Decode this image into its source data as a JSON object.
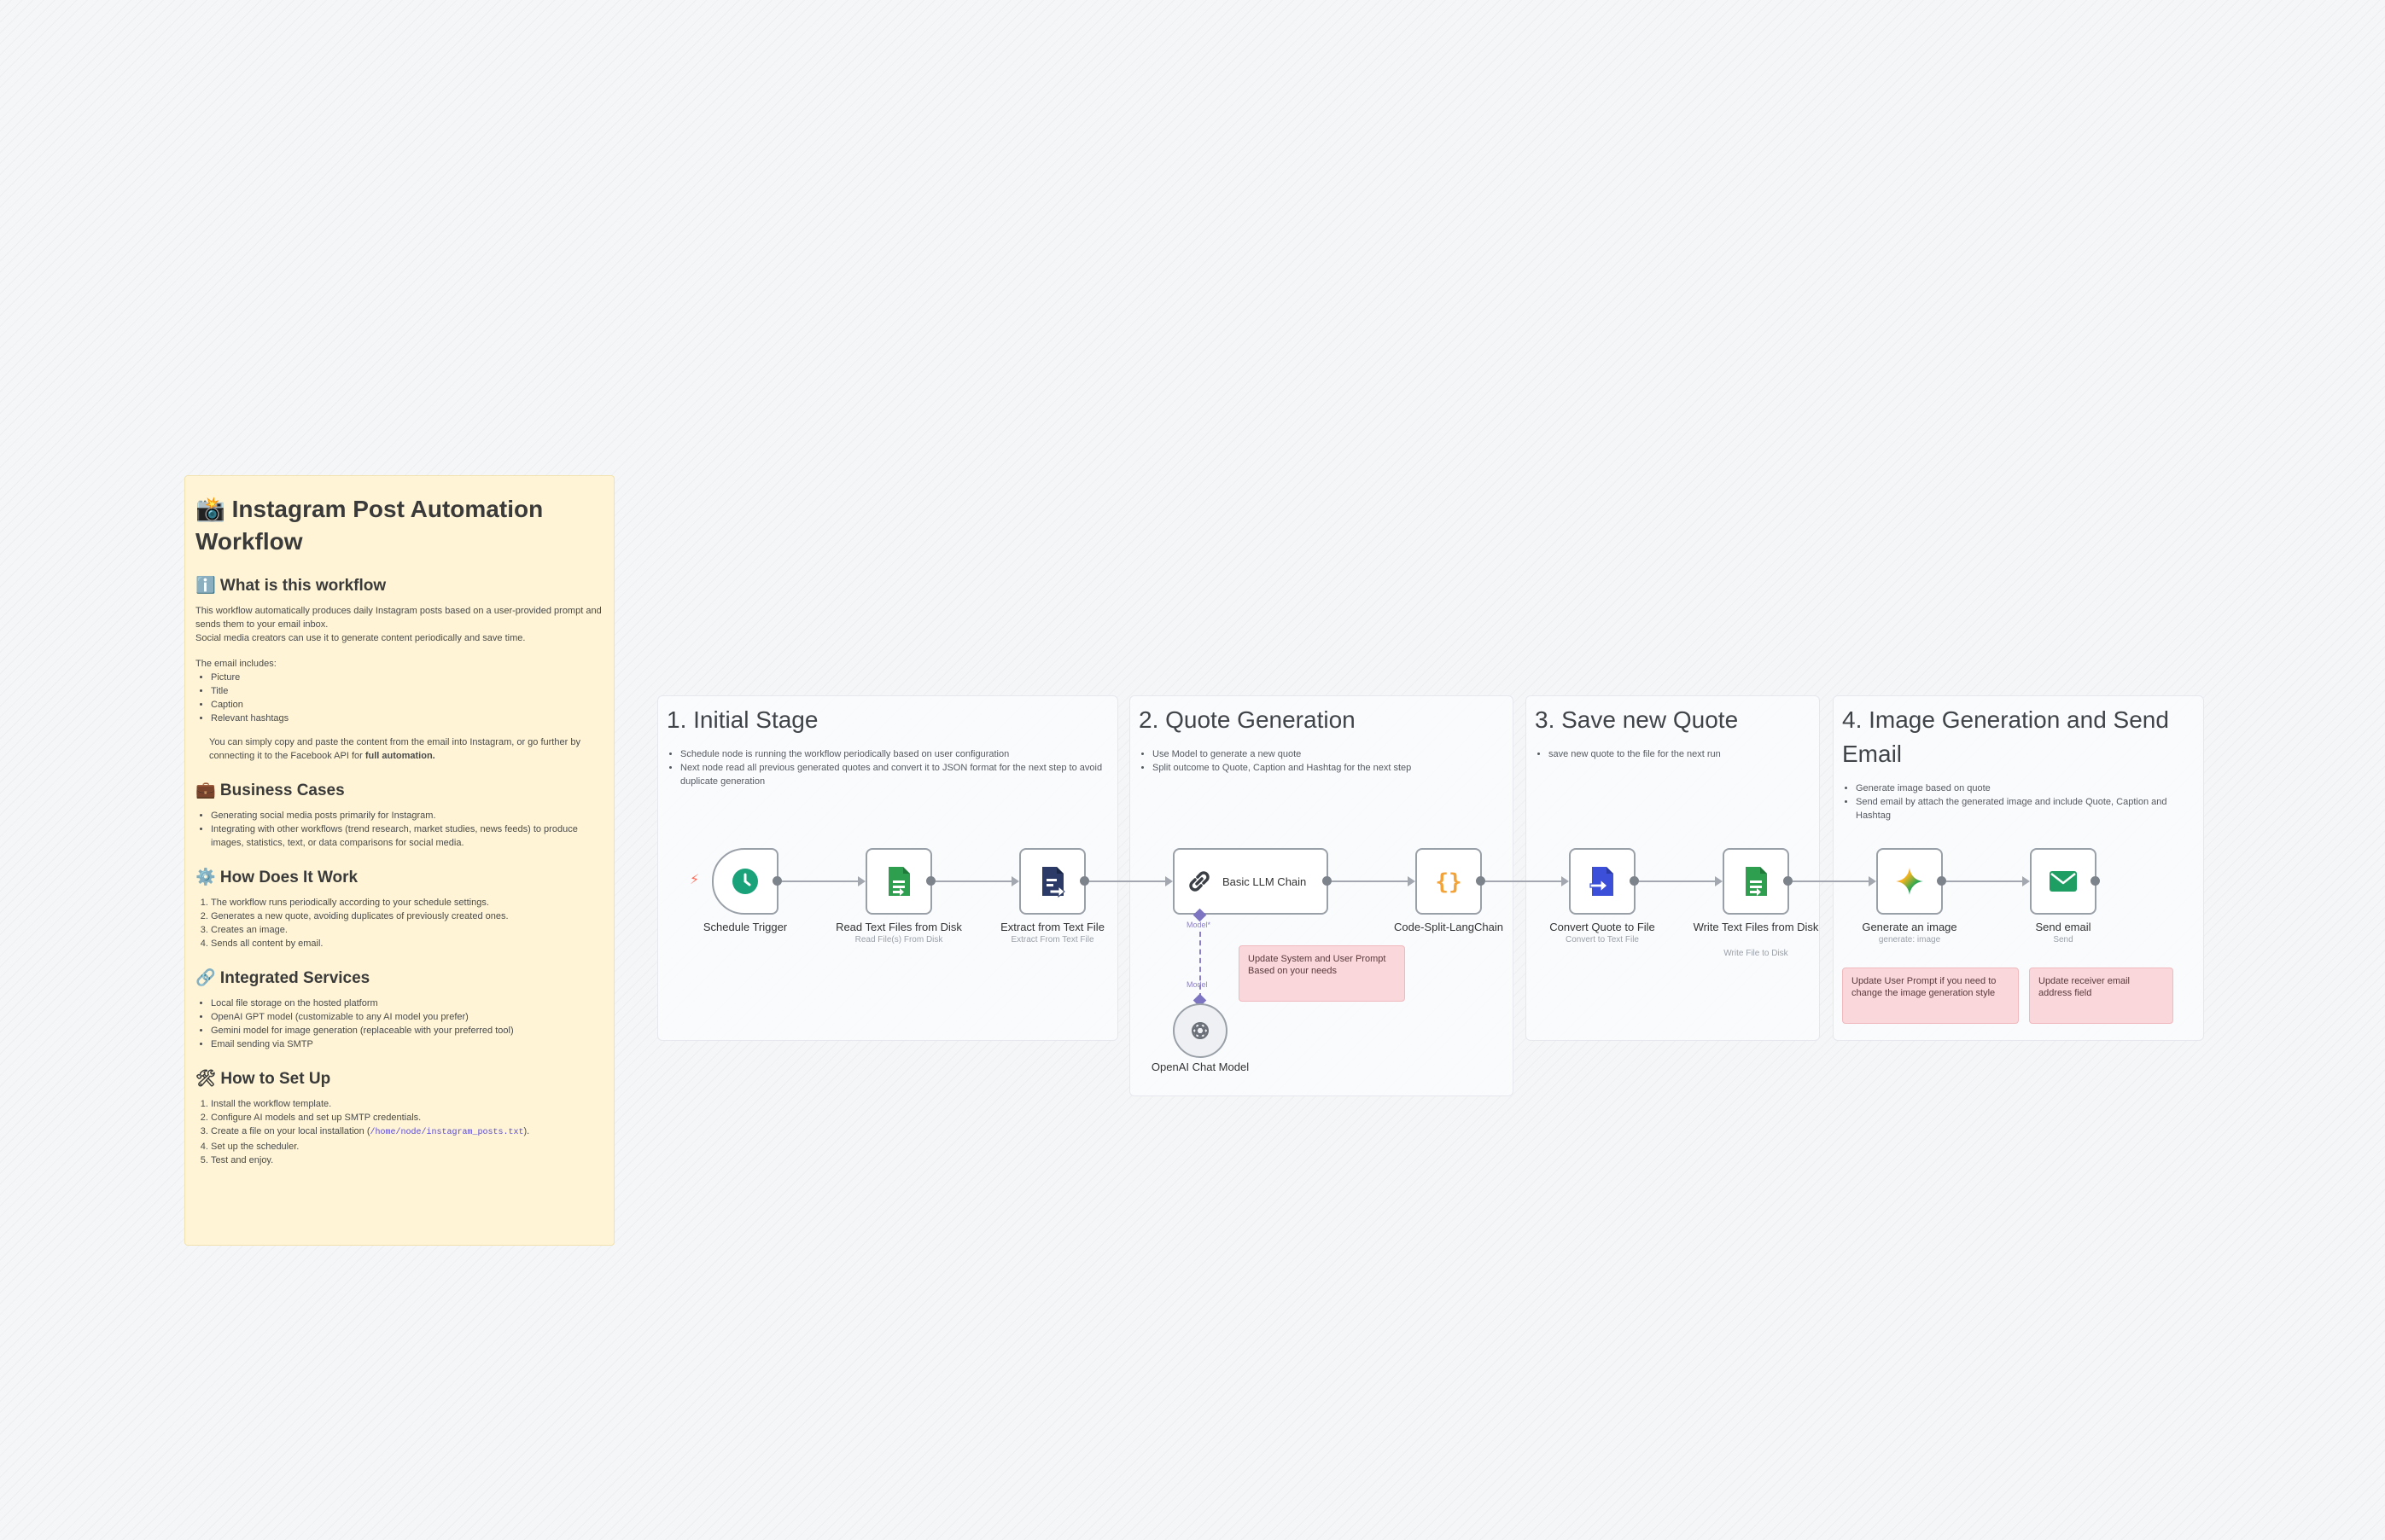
{
  "main_note": {
    "title": "📸 Instagram Post Automation Workflow",
    "what_heading": "ℹ️ What is this workflow",
    "what_p1": "This workflow automatically produces daily Instagram posts based on a user-provided prompt and sends them to your email inbox.",
    "what_p2": "Social media creators can use it to generate content periodically and save time.",
    "email_includes": "The email includes:",
    "email_items": [
      "Picture",
      "Title",
      "Caption",
      "Relevant hashtags"
    ],
    "tip_text": "You can simply copy and paste the content from the email into Instagram, or go further by connecting it to the Facebook API for",
    "tip_bold": "full automation.",
    "business_heading": "💼 Business Cases",
    "business_items": [
      "Generating social media posts primarily for Instagram.",
      "Integrating with other workflows (trend research, market studies, news feeds) to produce images, statistics, text, or data comparisons for social media."
    ],
    "how_heading": "⚙️ How Does It Work",
    "how_items": [
      "The workflow runs periodically according to your schedule settings.",
      "Generates a new quote, avoiding duplicates of previously created ones.",
      "Creates an image.",
      "Sends all content by email."
    ],
    "services_heading": "🔗 Integrated Services",
    "services_items": [
      "Local file storage on the hosted platform",
      "OpenAI GPT model (customizable to any AI model you prefer)",
      "Gemini model for image generation (replaceable with your preferred tool)",
      "Email sending via SMTP"
    ],
    "setup_heading": "🛠 How to Set Up",
    "setup_1": "Install the workflow template.",
    "setup_2": "Configure AI models and set up SMTP credentials.",
    "setup_3_pre": "Create a file on your local installation (",
    "setup_3_code": "/home/node/instagram_posts.txt",
    "setup_3_post": ").",
    "setup_4": "Set up the scheduler.",
    "setup_5": "Test and enjoy."
  },
  "sections": {
    "s1": {
      "title": "1. Initial Stage",
      "items": [
        "Schedule node is running the workflow periodically based on user configuration",
        "Next node read all previous generated quotes and convert it to JSON format for the next step to avoid duplicate generation"
      ]
    },
    "s2": {
      "title": "2. Quote Generation",
      "items": [
        "Use Model to generate a new quote",
        "Split outcome to Quote, Caption and Hashtag for the next step"
      ]
    },
    "s3": {
      "title": "3. Save new Quote",
      "items": [
        "save new quote to the file for the next run"
      ]
    },
    "s4": {
      "title": "4. Image Generation and Send Email",
      "items": [
        "Generate image based on quote",
        "Send email by attach the generated image and include Quote, Caption and Hashtag"
      ]
    }
  },
  "nodes": {
    "schedule": {
      "label": "Schedule Trigger",
      "icon": "clock-icon"
    },
    "read": {
      "label": "Read Text Files from Disk",
      "sub": "Read File(s) From Disk",
      "icon": "file-read-icon"
    },
    "extract": {
      "label": "Extract from Text File",
      "sub": "Extract From Text File",
      "icon": "file-extract-icon"
    },
    "llm": {
      "label": "Basic LLM Chain",
      "icon": "link-chain-icon",
      "model_label": "Model*"
    },
    "code": {
      "label": "Code-Split-LangChain",
      "icon": "braces-icon"
    },
    "convert": {
      "label": "Convert Quote to File",
      "sub": "Convert to Text File",
      "icon": "file-convert-icon"
    },
    "write": {
      "label": "Write Text Files from Disk",
      "sub": "Write File to Disk",
      "icon": "file-write-icon"
    },
    "image": {
      "label": "Generate an image",
      "sub": "generate: image",
      "icon": "gemini-sparkle-icon"
    },
    "email": {
      "label": "Send email",
      "sub": "Send",
      "icon": "envelope-icon"
    },
    "openai": {
      "label": "OpenAI Chat Model",
      "icon": "openai-icon",
      "port_label": "Model"
    }
  },
  "pink_notes": {
    "system_prompt": "Update System and User Prompt Based on your needs",
    "image_prompt": "Update User Prompt if you need to change the image generation style",
    "receiver": "Update receiver email address field"
  },
  "colors": {
    "sticky_yellow": "#fff5d6",
    "pink_note": "#f9d7da",
    "schedule_green": "#1aa37a",
    "file_green": "#2e9e4f",
    "file_navy": "#2b3a67",
    "code_orange": "#f2a33a",
    "convert_blue": "#3b4fd8",
    "email_green": "#1e9e63",
    "model_purple": "#7d74c2"
  }
}
